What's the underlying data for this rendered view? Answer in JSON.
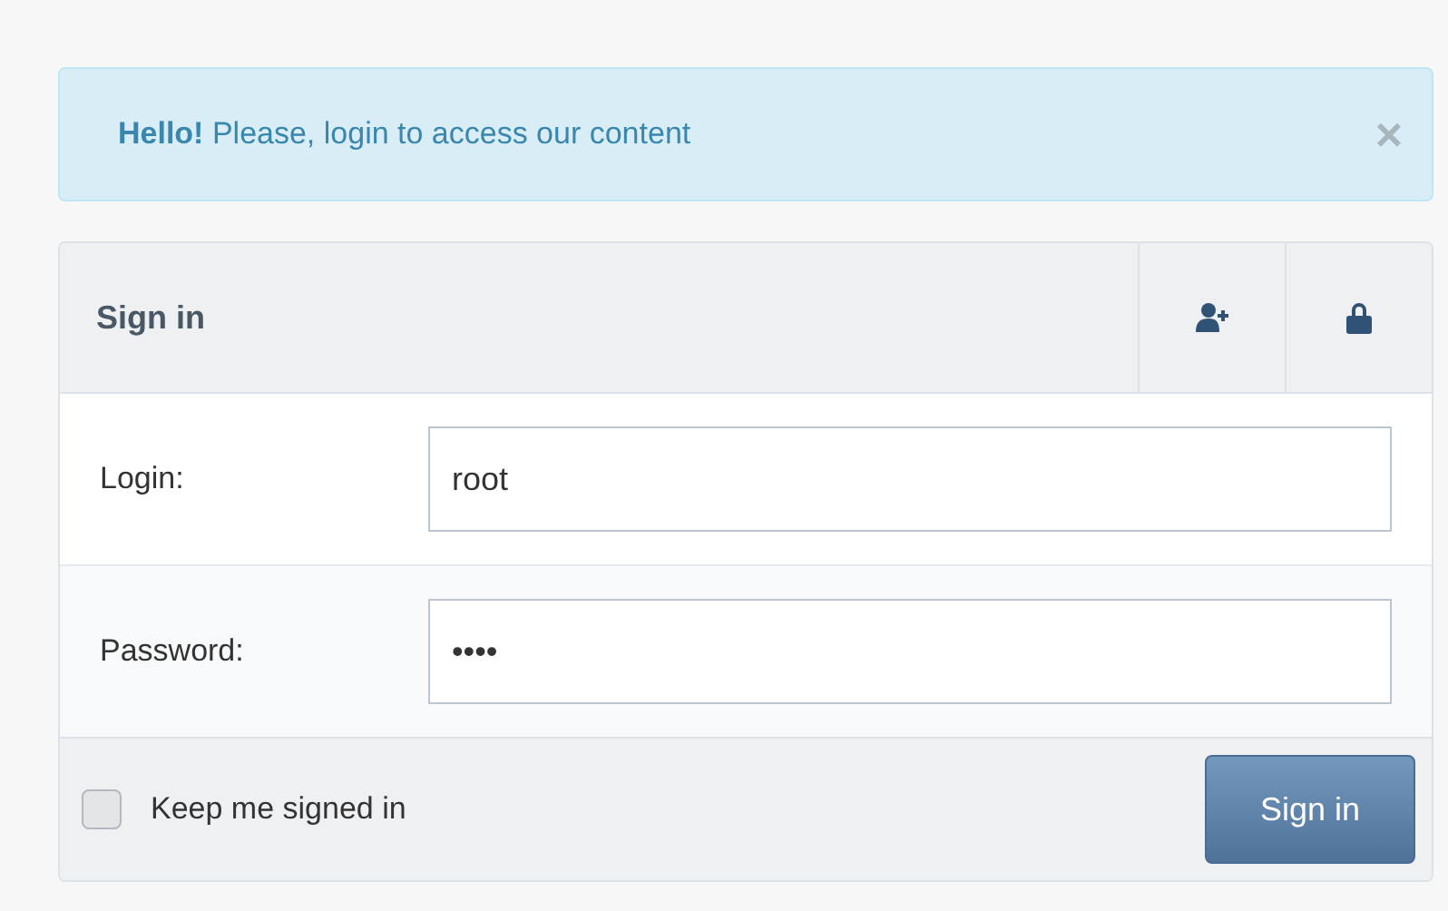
{
  "alert": {
    "message": "**Hello!** Please, login to access our content",
    "close": "×"
  },
  "panel": {
    "title": "Sign in",
    "fields": [
      {
        "label": "Login:",
        "value": "root"
      },
      {
        "label": "Password:",
        "value": "••••"
      }
    ],
    "remember": {
      "label": "Keep me signed in",
      "checked": false
    },
    "submit": "Sign in"
  }
}
